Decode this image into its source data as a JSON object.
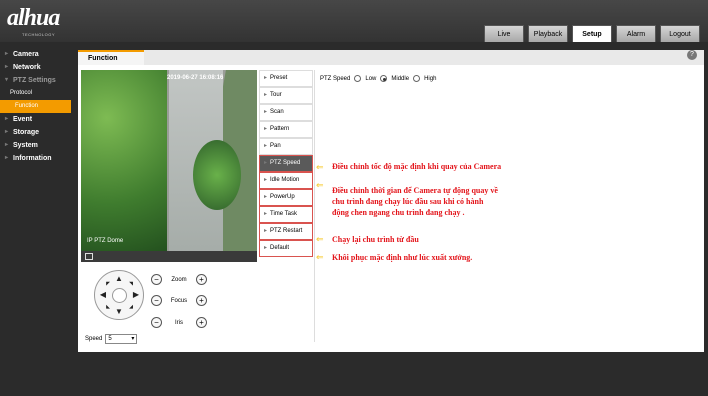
{
  "header": {
    "logo_text": "alhua",
    "logo_sub": "TECHNOLOGY",
    "tabs": [
      "Live",
      "Playback",
      "Setup",
      "Alarm",
      "Logout"
    ]
  },
  "sidebar": {
    "items": [
      {
        "label": "Camera"
      },
      {
        "label": "Network"
      },
      {
        "label": "PTZ Settings"
      },
      {
        "label": "Protocol"
      },
      {
        "label": "Function"
      },
      {
        "label": "Event"
      },
      {
        "label": "Storage"
      },
      {
        "label": "System"
      },
      {
        "label": "Information"
      }
    ]
  },
  "main": {
    "tab": "Function",
    "help": "?"
  },
  "video": {
    "osd_time": "2019-06-27 16:08:16",
    "osd_name": "IP PTZ Dome"
  },
  "menu": {
    "items": [
      "Preset",
      "Tour",
      "Scan",
      "Pattern",
      "Pan",
      "PTZ Speed",
      "Idle Motion",
      "PowerUp",
      "Time Task",
      "PTZ Restart",
      "Default"
    ]
  },
  "ptz_speed": {
    "label": "PTZ Speed",
    "options": [
      "Low",
      "Middle",
      "High"
    ],
    "selected": "Middle"
  },
  "notes": [
    "Điều chỉnh tốc độ mặc định khi quay của Camera",
    "Điều chỉnh thời gian để Camera tự động quay về",
    "chu trình đang chạy lúc đầu sau khi có hành",
    "động chen ngang chu trình đang chạy .",
    "Chạy lại chu trình từ đầu",
    "Khôi phục mặc định như lúc xuất xưởng."
  ],
  "controls": {
    "zoom": "Zoom",
    "focus": "Focus",
    "iris": "Iris",
    "minus": "−",
    "plus": "+",
    "speed_label": "Speed",
    "speed_value": "5"
  },
  "colors": {
    "accent": "#f39b00",
    "note": "#e3141a"
  }
}
